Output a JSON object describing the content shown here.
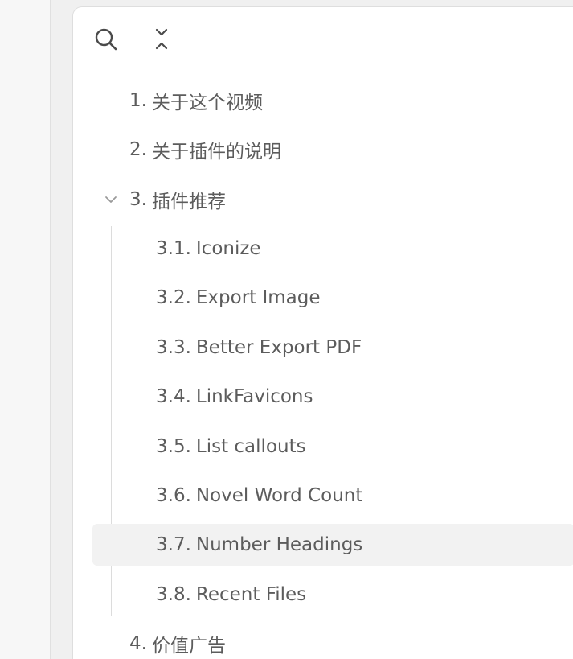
{
  "toolbar": {
    "search_icon": "search-icon",
    "collapse_icon": "collapse-all-icon"
  },
  "outline": {
    "items": [
      {
        "number": "1.",
        "label": "关于这个视频",
        "level": 1
      },
      {
        "number": "2.",
        "label": "关于插件的说明",
        "level": 1
      },
      {
        "number": "3.",
        "label": "插件推荐",
        "level": 1,
        "expanded": true
      },
      {
        "number": "3.1.",
        "label": "Iconize",
        "level": 2
      },
      {
        "number": "3.2.",
        "label": "Export Image",
        "level": 2
      },
      {
        "number": "3.3.",
        "label": "Better Export PDF",
        "level": 2
      },
      {
        "number": "3.4.",
        "label": "LinkFavicons",
        "level": 2
      },
      {
        "number": "3.5.",
        "label": "List callouts",
        "level": 2
      },
      {
        "number": "3.6.",
        "label": "Novel Word Count",
        "level": 2
      },
      {
        "number": "3.7.",
        "label": "Number Headings",
        "level": 2,
        "active": true
      },
      {
        "number": "3.8.",
        "label": "Recent Files",
        "level": 2
      },
      {
        "number": "4.",
        "label": "价值广告",
        "level": 1
      }
    ]
  },
  "colors": {
    "text": "#5c5c5c",
    "active_bg": "#f2f2f2",
    "panel_bg": "#ffffff",
    "guide": "#dcdcdc"
  }
}
